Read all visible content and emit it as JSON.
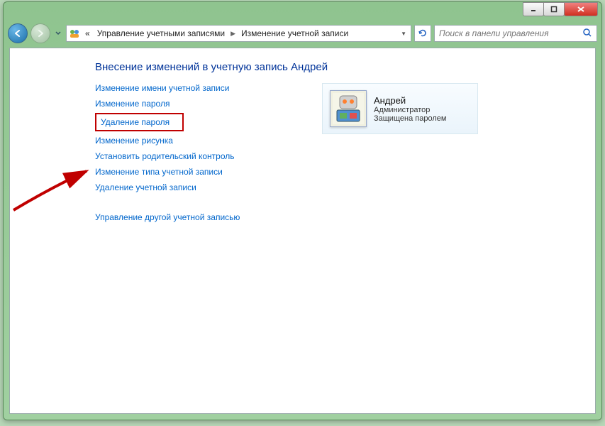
{
  "breadcrumb": {
    "prefix": "«",
    "item1": "Управление учетными записями",
    "item2": "Изменение учетной записи"
  },
  "search": {
    "placeholder": "Поиск в панели управления"
  },
  "page": {
    "heading": "Внесение изменений в учетную запись Андрей"
  },
  "links": {
    "change_name": "Изменение имени учетной записи",
    "change_password": "Изменение пароля",
    "delete_password": "Удаление пароля",
    "change_picture": "Изменение рисунка",
    "parental_control": "Установить родительский контроль",
    "change_type": "Изменение типа учетной записи",
    "delete_account": "Удаление учетной записи",
    "manage_other": "Управление другой учетной записью"
  },
  "user": {
    "name": "Андрей",
    "role": "Администратор",
    "status": "Защищена паролем"
  }
}
